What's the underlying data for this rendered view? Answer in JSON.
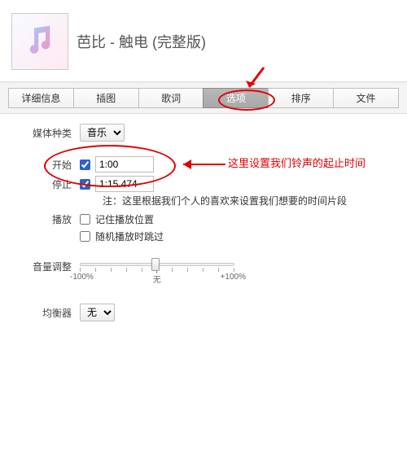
{
  "header": {
    "title": "芭比 - 触电 (完整版)",
    "artwork_icon": "music-note-icon"
  },
  "tabs": [
    {
      "label": "详细信息",
      "active": false
    },
    {
      "label": "插图",
      "active": false
    },
    {
      "label": "歌词",
      "active": false
    },
    {
      "label": "选项",
      "active": true
    },
    {
      "label": "排序",
      "active": false
    },
    {
      "label": "文件",
      "active": false
    }
  ],
  "options": {
    "media_type": {
      "label": "媒体种类",
      "value": "音乐"
    },
    "start": {
      "label": "开始",
      "checked": true,
      "value": "1:00"
    },
    "stop": {
      "label": "停止",
      "checked": true,
      "value": "1:15.474"
    },
    "note": "注：这里根据我们个人的喜欢来设置我们想要的时间片段",
    "playback": {
      "label": "播放",
      "remember_position": {
        "label": "记住播放位置",
        "checked": false
      },
      "skip_shuffle": {
        "label": "随机播放时跳过",
        "checked": false
      }
    },
    "volume": {
      "label": "音量调整",
      "min_label": "-100%",
      "mid_label": "无",
      "max_label": "+100%",
      "value": 0
    },
    "equalizer": {
      "label": "均衡器",
      "value": "无"
    }
  },
  "annotations": {
    "time_tip": "这里设置我们铃声的起止时间"
  }
}
